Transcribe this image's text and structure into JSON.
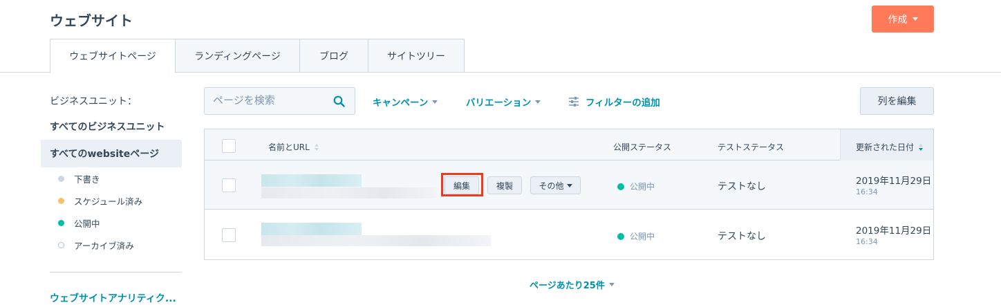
{
  "header": {
    "title": "ウェブサイト",
    "create_label": "作成"
  },
  "tabs": [
    {
      "label": "ウェブサイトページ",
      "active": true
    },
    {
      "label": "ランディングページ",
      "active": false
    },
    {
      "label": "ブログ",
      "active": false
    },
    {
      "label": "サイトツリー",
      "active": false
    }
  ],
  "sidebar": {
    "business_unit_label": "ビジネスユニット：",
    "business_unit_value": "すべてのビジネスユニット",
    "selected_view": "すべてのwebsiteページ",
    "items": [
      {
        "label": "下書き",
        "dot_color": "#cbd6e2"
      },
      {
        "label": "スケジュール済み",
        "dot_color": "#f5c26b"
      },
      {
        "label": "公開中",
        "dot_color": "#00bda5"
      },
      {
        "label": "アーカイブ済み",
        "dot_color": "outline"
      }
    ],
    "analytics_link": "ウェブサイトアナリティク..."
  },
  "toolbar": {
    "search_placeholder": "ページを検索",
    "campaign_label": "キャンペーン",
    "variation_label": "バリエーション",
    "add_filter_label": "フィルターの追加",
    "edit_columns_label": "列を編集"
  },
  "table": {
    "columns": [
      "名前とURL",
      "公開ステータス",
      "テストステータス",
      "更新された日付"
    ],
    "row_actions": {
      "edit": "編集",
      "clone": "複製",
      "more": "その他"
    },
    "rows": [
      {
        "publish_status": "公開中",
        "test_status": "テストなし",
        "date": "2019年11月29日",
        "time": "16:34"
      },
      {
        "publish_status": "公開中",
        "test_status": "テストなし",
        "date": "2019年11月29日",
        "time": "16:34"
      }
    ]
  },
  "pagination": {
    "per_page_label": "ページあたり25件"
  },
  "colors": {
    "accent_orange": "#ff7a59",
    "link_teal": "#0091ae",
    "published_green": "#00bda5",
    "highlight_red": "#ee3b1e"
  }
}
